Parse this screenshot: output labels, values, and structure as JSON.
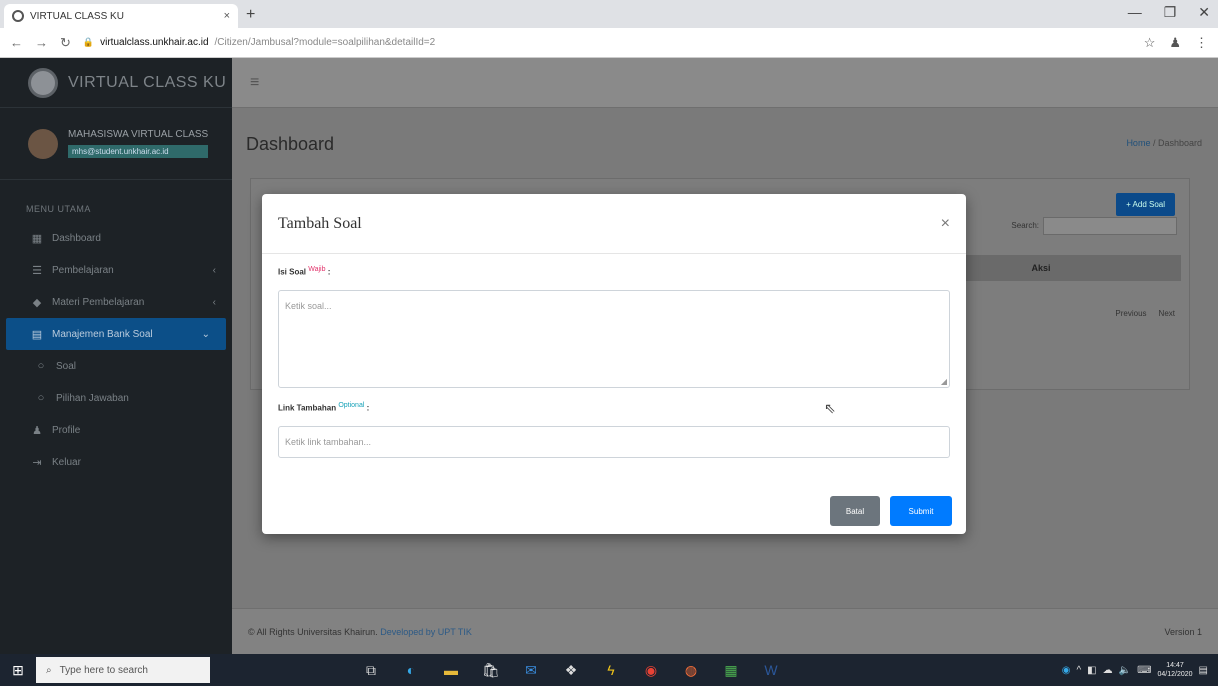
{
  "browser": {
    "tab_title": "VIRTUAL CLASS KU",
    "tab_close": "×",
    "new_tab": "+",
    "url_host": "virtualclass.unkhair.ac.id",
    "url_path": "/Citizen/Jambusal?module=soalpilihan&detailId=2",
    "win_min": "—",
    "win_max": "❐",
    "win_close": "✕"
  },
  "sidebar": {
    "brand": "VIRTUAL CLASS KU",
    "user_name": "MAHASISWA VIRTUAL CLASS",
    "user_email": "mhs@student.unkhair.ac.id",
    "menu_header": "MENU UTAMA",
    "items": [
      {
        "label": "Dashboard",
        "icon": "▦",
        "chevron": ""
      },
      {
        "label": "Pembelajaran",
        "icon": "☰",
        "chevron": "‹"
      },
      {
        "label": "Materi Pembelajaran",
        "icon": "◆",
        "chevron": "‹"
      },
      {
        "label": "Manajemen Bank Soal",
        "icon": "▤",
        "chevron": "⌄"
      },
      {
        "label": "Soal",
        "icon": "○",
        "chevron": ""
      },
      {
        "label": "Pilihan Jawaban",
        "icon": "○",
        "chevron": ""
      },
      {
        "label": "Profile",
        "icon": "♟",
        "chevron": ""
      },
      {
        "label": "Keluar",
        "icon": "⇥",
        "chevron": ""
      }
    ]
  },
  "content": {
    "menu_icon": "≡",
    "title": "Dashboard",
    "breadcrumb_home": "Home",
    "breadcrumb_sep": " / ",
    "breadcrumb_current": "Dashboard",
    "add_button": "+ Add Soal",
    "search_label": "Search:",
    "table_header": "Aksi",
    "prev": "Previous",
    "next": "Next",
    "footer_left": "© All Rights Universitas Khairun.",
    "footer_team": "Developed by UPT TIK",
    "footer_right": "Version 1"
  },
  "modal": {
    "title": "Tambah Soal",
    "close": "×",
    "field1_label": "Isi Soal",
    "field1_req": "Wajib",
    "field1_colon": ":",
    "field1_placeholder": "Ketik soal...",
    "field2_label": "Link Tambahan",
    "field2_opt": "Optional",
    "field2_colon": ":",
    "field2_placeholder": "Ketik link tambahan...",
    "cancel": "Batal",
    "submit": "Submit"
  },
  "taskbar": {
    "search_placeholder": "Type here to search",
    "time": "14:47",
    "date": "04/12/2020"
  },
  "colors": {
    "accent": "#007bff",
    "sidebar_bg": "#1d2226",
    "required": "#e2336b",
    "optional": "#17a2b8"
  }
}
